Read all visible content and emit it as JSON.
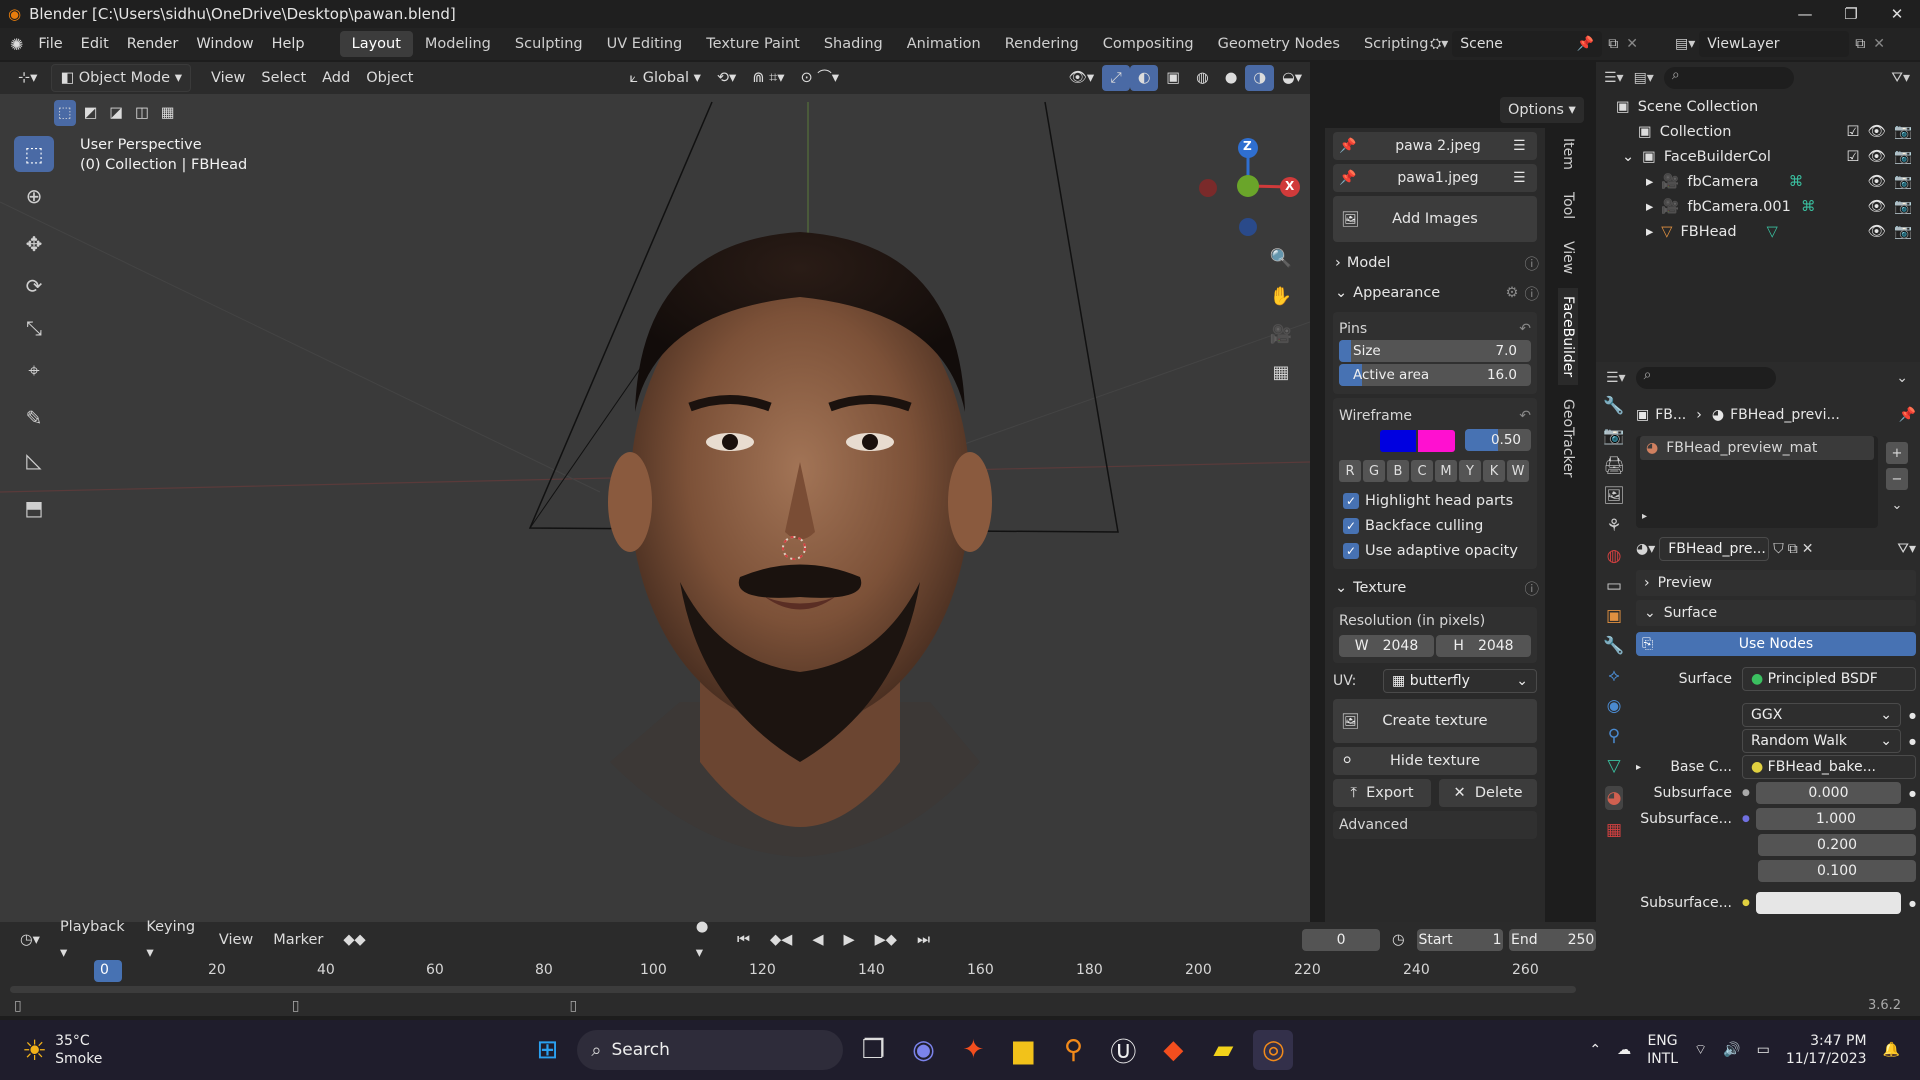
{
  "titlebar": {
    "title": "Blender [C:\\Users\\sidhu\\OneDrive\\Desktop\\pawan.blend]"
  },
  "menu": {
    "items": [
      "File",
      "Edit",
      "Render",
      "Window",
      "Help"
    ]
  },
  "workspaces": [
    "Layout",
    "Modeling",
    "Sculpting",
    "UV Editing",
    "Texture Paint",
    "Shading",
    "Animation",
    "Rendering",
    "Compositing",
    "Geometry Nodes",
    "Scripting"
  ],
  "scene": {
    "label": "Scene",
    "viewlayer": "ViewLayer"
  },
  "viewport_header": {
    "mode": "Object Mode",
    "menus": [
      "View",
      "Select",
      "Add",
      "Object"
    ],
    "transform": "Global",
    "options": "Options"
  },
  "viewport": {
    "perspective": "User Perspective",
    "collection": "(0) Collection | FBHead"
  },
  "gizmo": {
    "z": "Z",
    "y": "",
    "x": "X"
  },
  "npanel": {
    "images": [
      "pawa 2.jpeg",
      "pawa1.jpeg"
    ],
    "add_images": "Add Images",
    "model": "Model",
    "appearance": "Appearance",
    "pins": "Pins",
    "size_label": "Size",
    "size_value": "7.0",
    "area_label": "Active area",
    "area_value": "16.0",
    "wireframe": "Wireframe",
    "wire_opacity": "0.50",
    "rgb": [
      "R",
      "G",
      "B",
      "C",
      "M",
      "Y",
      "K",
      "W"
    ],
    "highlight": "Highlight head parts",
    "backface": "Backface culling",
    "adaptive": "Use adaptive opacity",
    "texture": "Texture",
    "resolution": "Resolution (in pixels)",
    "w_label": "W",
    "w_value": "2048",
    "h_label": "H",
    "h_value": "2048",
    "uv_label": "UV:",
    "uv_value": "butterfly",
    "create_texture": "Create texture",
    "hide_texture": "Hide texture",
    "export": "Export",
    "delete": "Delete",
    "advanced": "Advanced"
  },
  "vtabs": [
    "Item",
    "Tool",
    "View",
    "FaceBuilder",
    "GeoTracker"
  ],
  "outliner": {
    "rows": [
      {
        "label": "Scene Collection"
      },
      {
        "label": "Collection"
      },
      {
        "label": "FaceBuilderCol"
      },
      {
        "label": "fbCamera"
      },
      {
        "label": "fbCamera.001"
      },
      {
        "label": "FBHead"
      }
    ]
  },
  "props": {
    "breadcrumb1": "FB...",
    "breadcrumb2": "FBHead_previ...",
    "material": "FBHead_preview_mat",
    "mat_select": "FBHead_pre...",
    "preview": "Preview",
    "surface": "Surface",
    "use_nodes": "Use Nodes",
    "surface_label": "Surface",
    "surface_value": "Principled BSDF",
    "ggx": "GGX",
    "random_walk": "Random Walk",
    "base_color": "Base C...",
    "base_value": "FBHead_bake...",
    "subsurface": "Subsurface",
    "subsurface_value": "0.000",
    "subsurface2": "Subsurface...",
    "ss_r": "1.000",
    "ss_g": "0.200",
    "ss_b": "0.100",
    "subsurface3": "Subsurface..."
  },
  "timeline": {
    "menus": [
      "Playback",
      "Keying",
      "View",
      "Marker"
    ],
    "current": "0",
    "start_label": "Start",
    "start": "1",
    "end_label": "End",
    "end": "250",
    "ticks": [
      "0",
      "20",
      "40",
      "60",
      "80",
      "100",
      "120",
      "140",
      "160",
      "180",
      "200",
      "220",
      "240",
      "260"
    ],
    "version": "3.6.2"
  },
  "taskbar": {
    "temp": "35°C",
    "weather": "Smoke",
    "search": "Search",
    "lang1": "ENG",
    "lang2": "INTL",
    "time": "3:47 PM",
    "date": "11/17/2023"
  }
}
